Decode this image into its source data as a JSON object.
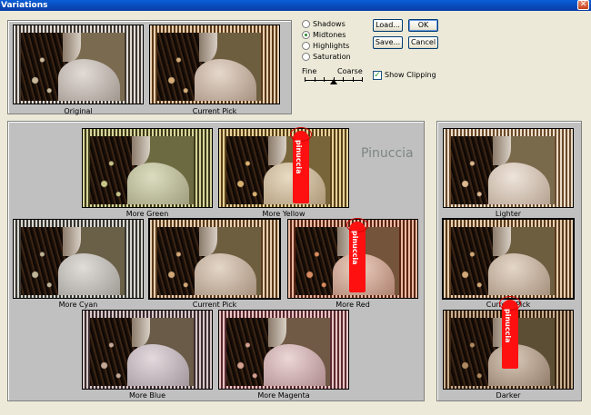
{
  "window": {
    "title": "Variations",
    "close_glyph": "✕",
    "close_icon": "close-icon"
  },
  "tone_options": [
    {
      "label": "Shadows",
      "checked": false
    },
    {
      "label": "Midtones",
      "checked": true
    },
    {
      "label": "Highlights",
      "checked": false
    },
    {
      "label": "Saturation",
      "checked": false
    }
  ],
  "buttons": {
    "load": "Load...",
    "ok": "OK",
    "save": "Save...",
    "cancel": "Cancel"
  },
  "slider": {
    "fine_label": "Fine",
    "coarse_label": "Coarse",
    "position_fraction": 0.5,
    "ticks": 7
  },
  "show_clipping": {
    "label": "Show Clipping",
    "checked": true,
    "glyph": "✓"
  },
  "top_previews": {
    "original": "Original",
    "current": "Current Pick"
  },
  "color_variations": {
    "more_green": "More Green",
    "more_yellow": "More Yellow",
    "more_cyan": "More Cyan",
    "current": "Current Pick",
    "more_red": "More Red",
    "more_blue": "More Blue",
    "more_magenta": "More Magenta"
  },
  "brightness_variations": {
    "lighter": "Lighter",
    "current": "Current Pick",
    "darker": "Darker"
  },
  "overlay": {
    "watermark": "Pinuccia",
    "tag_text": "pinuccia"
  },
  "colors": {
    "title_bar": "#0a5fd8",
    "tag_red": "#ff1010",
    "panel": "#c0c0c0",
    "dialog": "#ece9d8"
  }
}
